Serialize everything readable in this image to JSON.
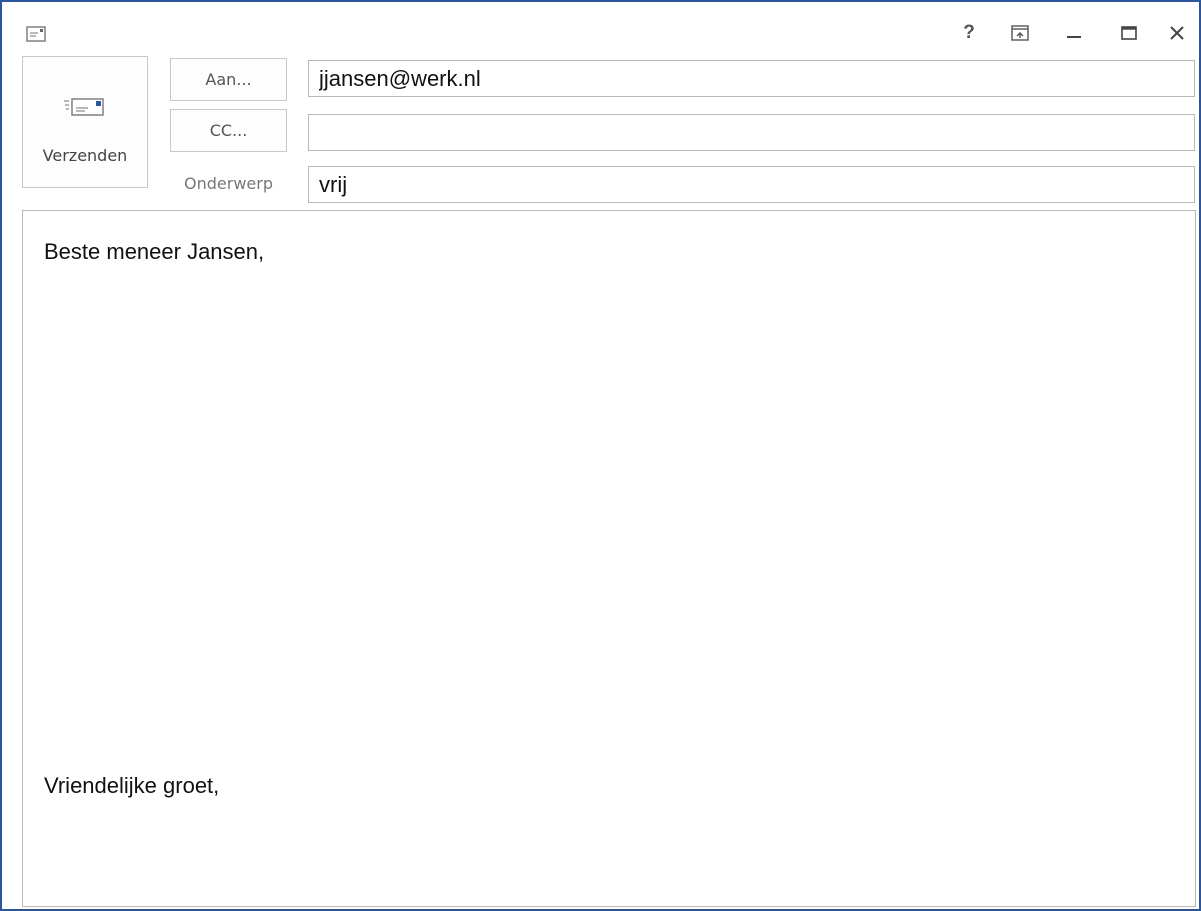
{
  "window": {
    "help_glyph": "?",
    "controls": [
      "help-icon",
      "ribbon-display-icon",
      "minimize-icon",
      "maximize-icon",
      "close-icon"
    ],
    "app_icon": "message-icon"
  },
  "toolbar": {
    "send_label": "Verzenden",
    "send_icon": "send-envelope-icon"
  },
  "header": {
    "to_button_label": "Aan...",
    "to_value": "jjansen@werk.nl",
    "cc_button_label": "CC...",
    "cc_value": "",
    "subject_label": "Onderwerp",
    "subject_value": "vrij"
  },
  "body": {
    "greeting": "Beste meneer Jansen,",
    "closing": "Vriendelijke groet,"
  },
  "colors": {
    "window_border": "#2b579a",
    "send_icon_accent": "#2b579a",
    "text": "#111111"
  }
}
